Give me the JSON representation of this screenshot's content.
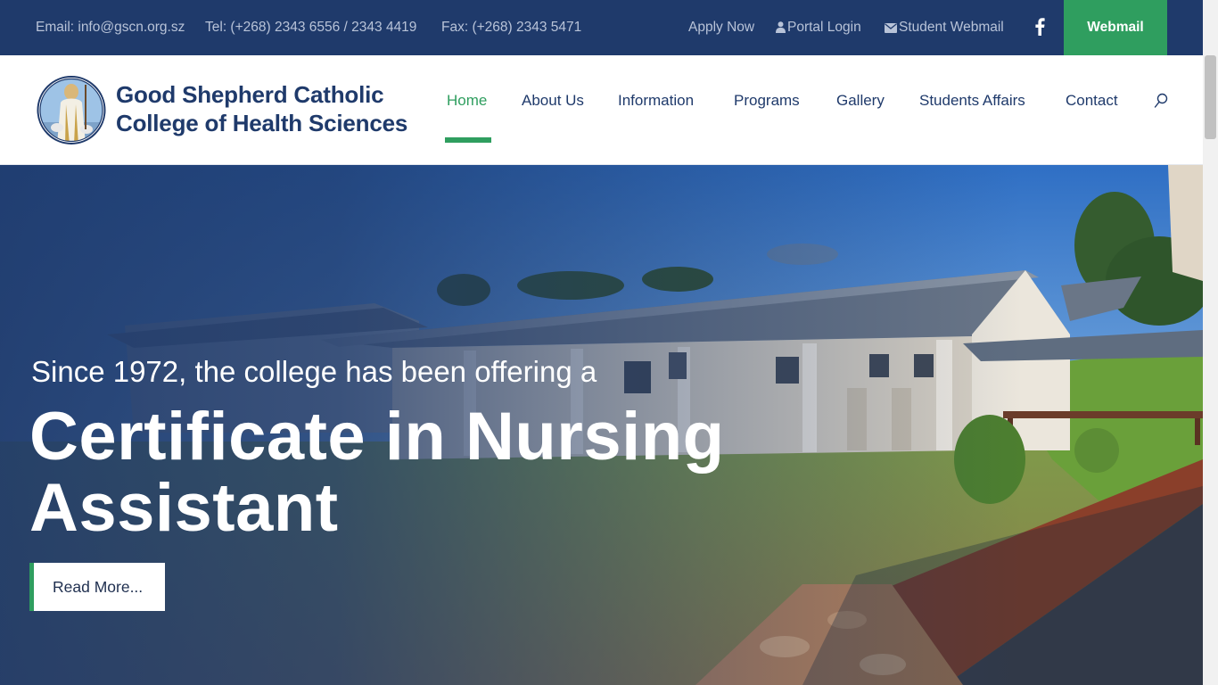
{
  "topbar": {
    "email": "Email: info@gscn.org.sz",
    "tel": "Tel: (+268) 2343 6556 / 2343 4419",
    "fax": "Fax: (+268) 2343 5471",
    "apply_now": "Apply Now",
    "portal_login": "Portal Login",
    "student_webmail": "Student Webmail",
    "webmail_button": "Webmail"
  },
  "header": {
    "logo_line1": "Good Shepherd Catholic",
    "logo_line2": "College of Health Sciences"
  },
  "nav": {
    "items": [
      {
        "label": "Home",
        "active": true
      },
      {
        "label": "About Us"
      },
      {
        "label": "Information"
      },
      {
        "label": "Programs"
      },
      {
        "label": "Gallery"
      },
      {
        "label": "Students Affairs"
      },
      {
        "label": "Contact"
      }
    ]
  },
  "hero": {
    "subtitle": "Since 1972, the college has been offering a",
    "title_line1": "Certificate in Nursing",
    "title_line2": "Assistant",
    "button": "Read More..."
  },
  "colors": {
    "brand_navy": "#1f3a6b",
    "accent_green": "#2f9e5f"
  },
  "icons": [
    "user-icon",
    "envelope-icon",
    "facebook-icon",
    "search-icon"
  ]
}
